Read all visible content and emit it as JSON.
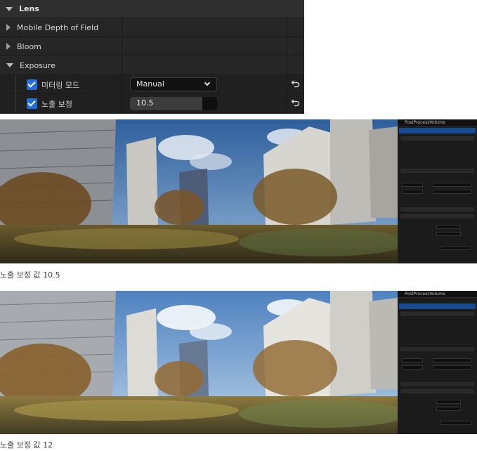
{
  "details_panel": {
    "section_title": "Lens",
    "groups": [
      "Mobile Depth of Field",
      "Bloom",
      "Exposure"
    ],
    "metering_mode": {
      "label": "미터링 모드",
      "checked": true,
      "value": "Manual"
    },
    "exposure_compensation": {
      "label": "노출 보정",
      "checked": true,
      "value": "10.5"
    }
  },
  "viewport_1": {
    "outliner_header": "PostProcessVolume",
    "caption": "노출 보정 값 10.5"
  },
  "viewport_2": {
    "outliner_header": "PostProcessVolume",
    "caption": "노출 보정 값 12"
  },
  "colors": {
    "accent": "#1f6fd6",
    "panel_bg": "#2a2a2a",
    "selection": "#174b8f"
  },
  "icons": {
    "collapsed": "triangle-right-icon",
    "expanded": "triangle-down-icon",
    "reset": "reset-arrow-icon",
    "dropdown": "chevron-down-icon",
    "checkbox": "checkmark-icon"
  }
}
